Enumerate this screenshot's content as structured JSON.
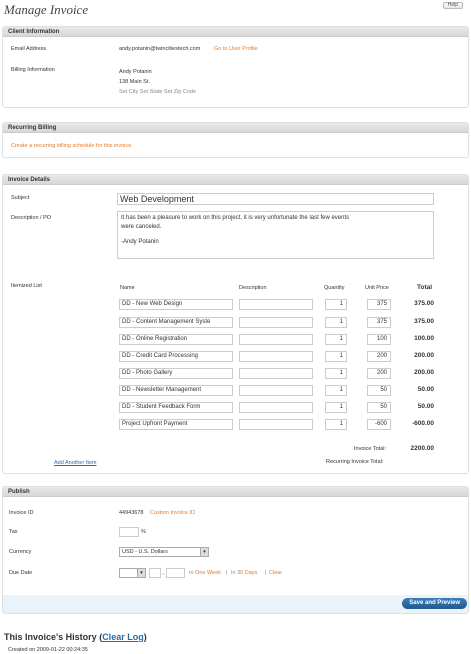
{
  "header": {
    "title": "Manage Invoice",
    "help_label": "Help"
  },
  "client": {
    "section_title": "Client Information",
    "email_label": "Email Address",
    "email_value": "andy.potanin@twincitiestech.com",
    "go_to_profile": "Go to User Profile",
    "billing_label": "Billing Information",
    "billing_name": "Andy Potanin",
    "billing_street": "138 Main St.",
    "billing_city": "Set City Set State Set Zip Code"
  },
  "recurring": {
    "section_title": "Recurring Billing",
    "create_link": "Create a recurring billing schedule for this invoice."
  },
  "details": {
    "section_title": "Invoice Details",
    "subject_label": "Subject",
    "subject_value": "Web Development",
    "description_label": "Description / PO",
    "description_line1": "It has been a pleasure to work on this project, it is very unfortunate the last few events",
    "description_line2": "were canceled.",
    "description_sign": "-Andy Potanin",
    "itemized_label": "Itemized List",
    "columns": {
      "name": "Name",
      "description": "Description",
      "quantity": "Quantity",
      "unit_price": "Unit Price",
      "total": "Total"
    },
    "items": [
      {
        "name": "DD - New Web Design",
        "description": "",
        "quantity": "1",
        "unit_price": "375",
        "total": "375.00"
      },
      {
        "name": "DD - Content Management Syste",
        "description": "",
        "quantity": "1",
        "unit_price": "375",
        "total": "375.00"
      },
      {
        "name": "DD - Online Registration",
        "description": "",
        "quantity": "1",
        "unit_price": "100",
        "total": "100.00"
      },
      {
        "name": "DD - Credit Card Processing",
        "description": "",
        "quantity": "1",
        "unit_price": "200",
        "total": "200.00"
      },
      {
        "name": "DD - Photo Gallery",
        "description": "",
        "quantity": "1",
        "unit_price": "200",
        "total": "200.00"
      },
      {
        "name": "DD - Newsletter Management",
        "description": "",
        "quantity": "1",
        "unit_price": "50",
        "total": "50.00"
      },
      {
        "name": "DD - Student Feedback Form",
        "description": "",
        "quantity": "1",
        "unit_price": "50",
        "total": "50.00"
      },
      {
        "name": "Project Upfront Payment",
        "description": "",
        "quantity": "1",
        "unit_price": "-600",
        "total": "-600.00"
      }
    ],
    "invoice_total_label": "Invoice Total:",
    "invoice_total_value": "2200.00",
    "recurring_total_label": "Recurring Invoice Total:",
    "add_item_link": "Add Another Item"
  },
  "publish": {
    "section_title": "Publish",
    "invoice_id_label": "Invoice ID",
    "invoice_id_value": "44943678",
    "custom_id_link": "Custom Invoice ID",
    "tax_label": "Tax",
    "tax_value": "",
    "tax_unit": "%",
    "currency_label": "Currency",
    "currency_value": "USD - U.S. Dollars",
    "due_date_label": "Due Date",
    "due_comma": ",",
    "in_one_week": "In One Week",
    "in_30_days": "In 30 Days",
    "clear": "Clear",
    "separator": "|"
  },
  "save_button": "Save and Preview",
  "history": {
    "title": "This Invoice's History",
    "clear_log": "Clear Log",
    "open_paren": "(",
    "close_paren": ")",
    "created": "Created on 2009-01-22 00:24:35"
  }
}
